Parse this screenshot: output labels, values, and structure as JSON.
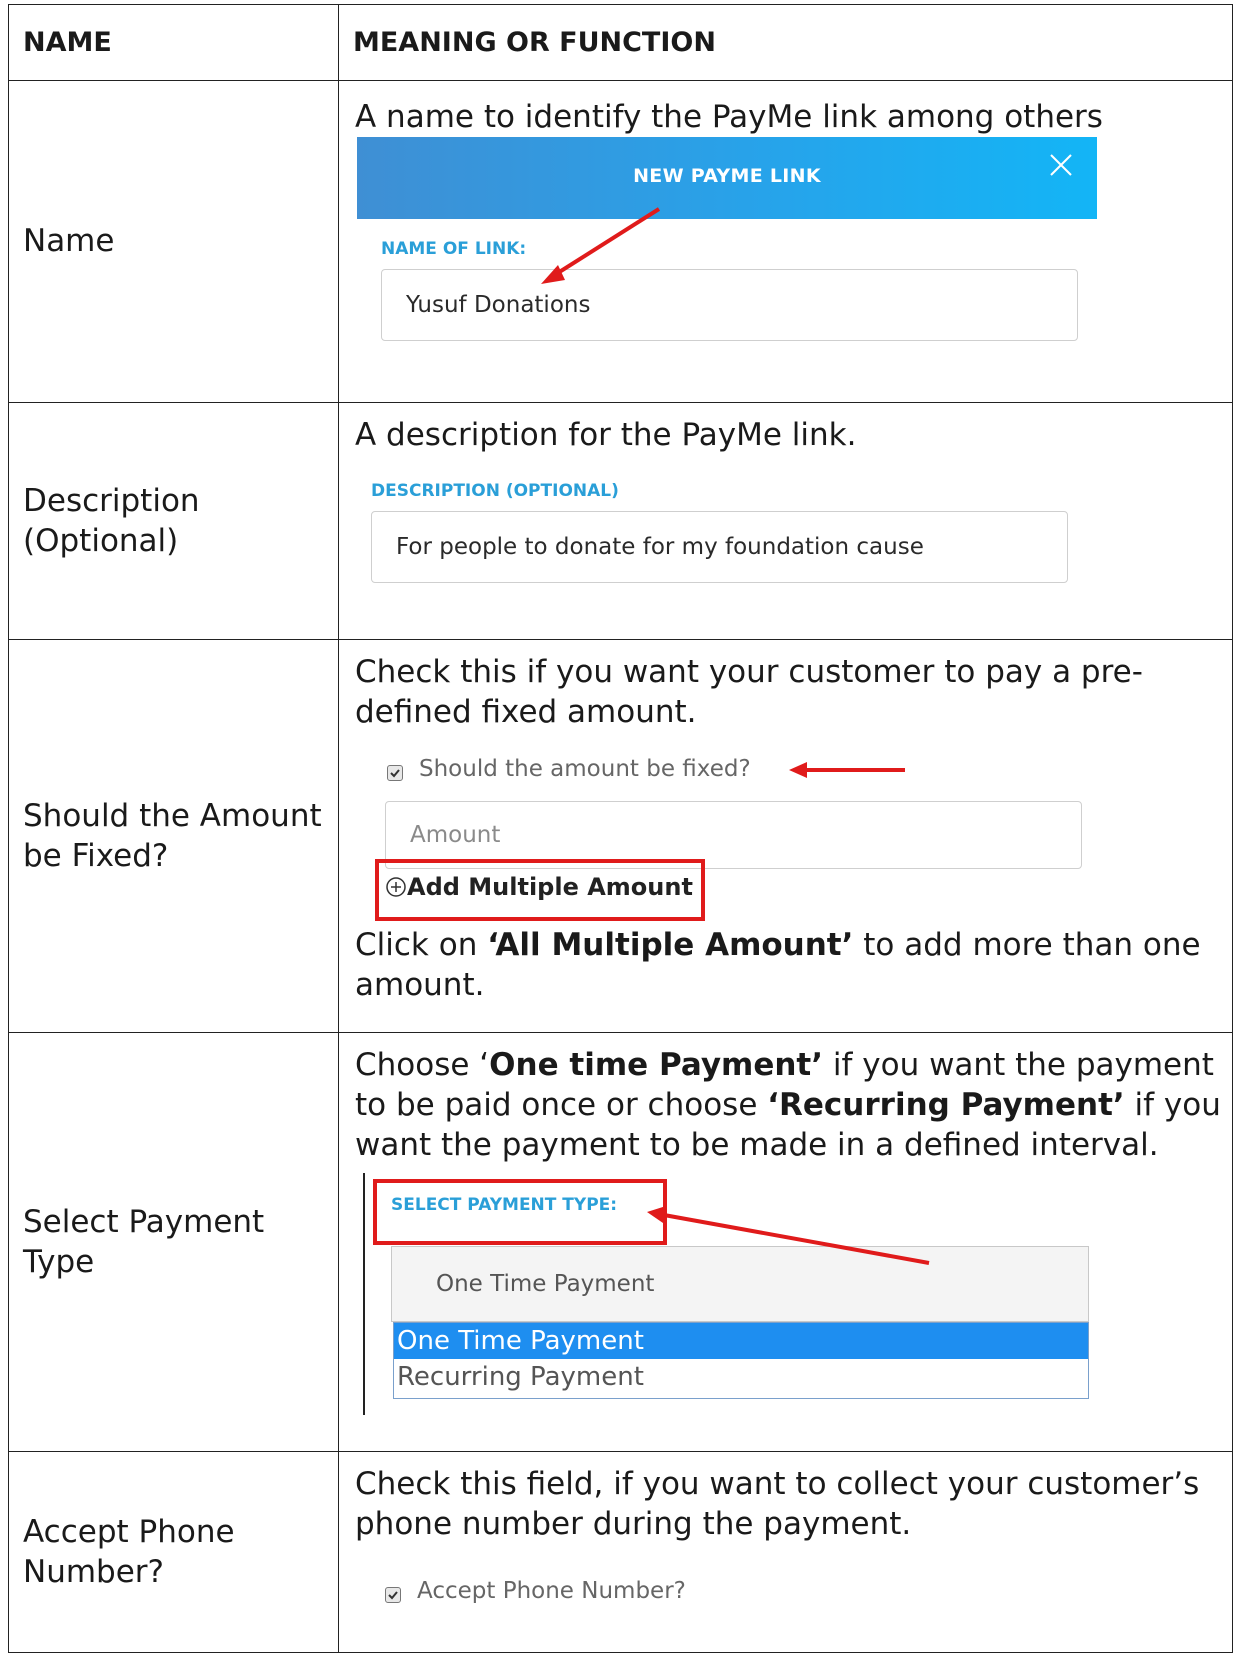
{
  "table": {
    "headers": {
      "name": "NAME",
      "meaning": "MEANING OR FUNCTION"
    },
    "rows": {
      "name": {
        "label": "Name",
        "description": "A name to identify the PayMe link among others",
        "mock": {
          "banner_title": "NEW PAYME LINK",
          "field_label": "NAME OF LINK:",
          "field_value": "Yusuf Donations"
        }
      },
      "description": {
        "label_line1": "Description",
        "label_line2": "(Optional)",
        "description": "A description for the PayMe link.",
        "mock": {
          "field_label": "DESCRIPTION (OPTIONAL)",
          "field_value": "For people to donate for my foundation cause"
        }
      },
      "fixed": {
        "label_line1": "Should the Amount",
        "label_line2": "be Fixed?",
        "description_line1": "Check this if you want your customer to pay a pre-",
        "description_line2": "defined fixed amount.",
        "mock": {
          "checkbox_label": "Should the amount be fixed?",
          "amount_placeholder": "Amount",
          "add_multiple": "Add Multiple Amount"
        },
        "note_prefix": "Click on ",
        "note_bold": "‘All Multiple Amount’",
        "note_suffix": " to add more than one",
        "note_line2": "amount."
      },
      "payment_type": {
        "label_line1": "Select Payment",
        "label_line2": "Type",
        "line1_prefix": "Choose ‘",
        "line1_bold": "One time Payment’",
        "line1_suffix": " if you want the payment",
        "line2_prefix": "to be paid once or choose ",
        "line2_bold": "‘Recurring Payment’",
        "line2_suffix": " if you",
        "line3": "want the payment to be made in a defined interval.",
        "mock": {
          "field_label": "SELECT PAYMENT TYPE:",
          "selected_value": "One Time Payment",
          "options": [
            "One Time Payment",
            "Recurring Payment"
          ]
        }
      },
      "phone": {
        "label_line1": "Accept Phone",
        "label_line2": "Number?",
        "description_line1": "Check this field, if you want to collect your customer’s",
        "description_line2": "phone number during the payment.",
        "mock": {
          "checkbox_label": "Accept Phone Number?"
        }
      }
    }
  },
  "colors": {
    "banner_start": "#3f8fd4",
    "banner_end": "#13b5f6",
    "mini_label": "#2a9fd8",
    "annotation_red": "#e01b1b",
    "selected_option": "#1e8ef0"
  },
  "icons": [
    "close-icon",
    "checkmark-icon",
    "plus-circle-icon",
    "arrow-annotation"
  ]
}
